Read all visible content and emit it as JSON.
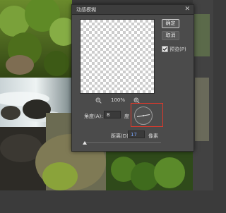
{
  "dialog": {
    "title": "动感模糊",
    "close_glyph": "✕",
    "ok_label": "确定",
    "cancel_label": "取消",
    "preview_label": "预览(P)",
    "preview_checked": true,
    "zoom_level": "100%",
    "angle_label": "角度(A):",
    "angle_value": "8",
    "angle_unit": "度",
    "distance_label": "距离(D):",
    "distance_value": "17",
    "distance_unit": "像素",
    "distance_slider_fraction": 0
  },
  "icons": {
    "zoom_out": "zoom-out-icon",
    "zoom_in": "zoom-in-icon",
    "checkmark": "checkmark-icon",
    "close": "close-icon"
  },
  "colors": {
    "highlight": "#e0392b",
    "dialog_bg": "#4b4b4b",
    "distance_value_color": "#79a6ff"
  }
}
